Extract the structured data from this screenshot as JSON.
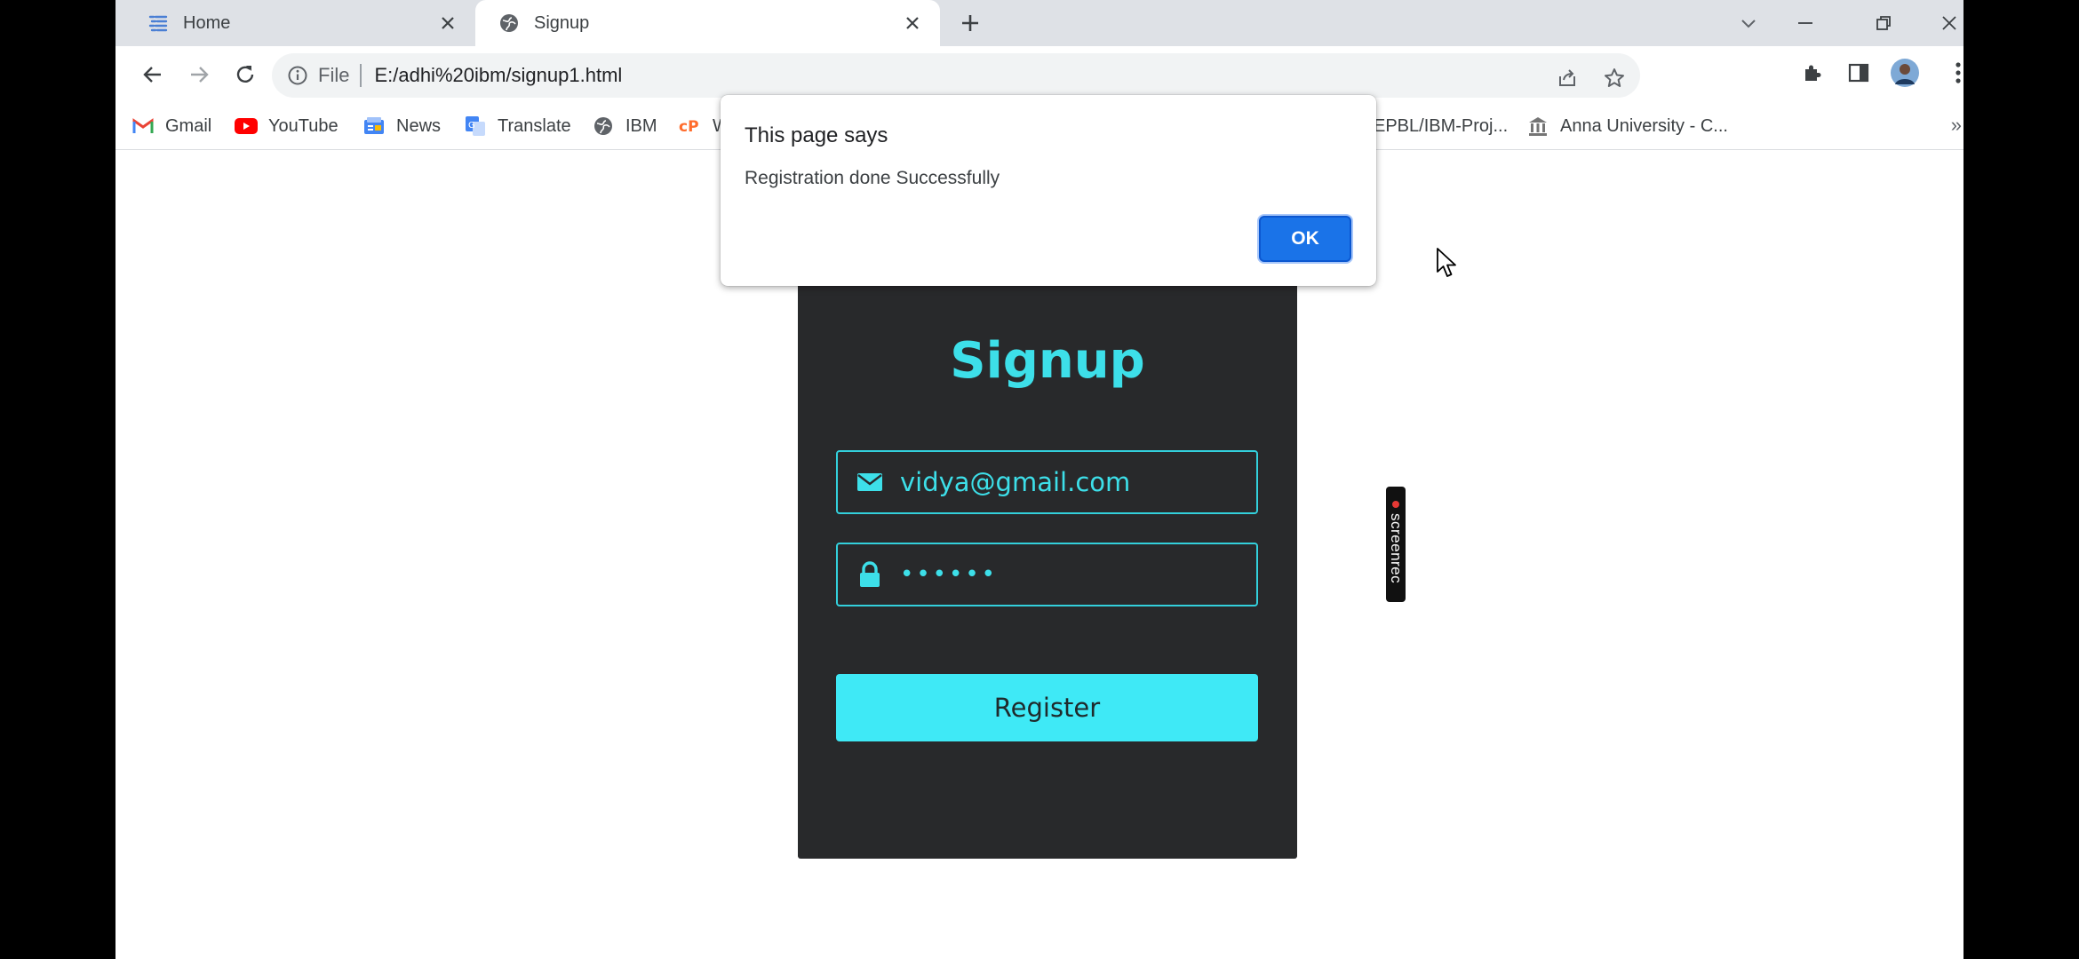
{
  "browser": {
    "tabs": [
      {
        "label": "Home",
        "icon": "list-icon",
        "active": false
      },
      {
        "label": "Signup",
        "icon": "globe-icon",
        "active": true
      }
    ],
    "address": {
      "scheme_label": "File",
      "url": "E:/adhi%20ibm/signup1.html"
    },
    "bookmarks": [
      {
        "label": "Gmail",
        "icon": "gmail-icon"
      },
      {
        "label": "YouTube",
        "icon": "youtube-icon"
      },
      {
        "label": "News",
        "icon": "news-icon"
      },
      {
        "label": "Translate",
        "icon": "translate-icon"
      },
      {
        "label": "IBM",
        "icon": "globe-icon"
      },
      {
        "label": "W",
        "icon": "cpanel-icon"
      },
      {
        "label": "EPBL/IBM-Proj...",
        "icon": "github-icon"
      },
      {
        "label": "Anna University - C...",
        "icon": "university-icon"
      }
    ],
    "bookmarks_more": "»"
  },
  "page": {
    "title": "Signup",
    "email_value": "vidya@gmail.com",
    "password_value": "••••••",
    "register_label": "Register",
    "colors": {
      "card_bg": "#28292b",
      "accent": "#3ddfe9",
      "button_bg": "#3fe9f6"
    }
  },
  "dialog": {
    "title": "This page says",
    "message": "Registration done Successfully",
    "ok_label": "OK"
  },
  "overlay": {
    "screenrec_label": "screenrec"
  }
}
